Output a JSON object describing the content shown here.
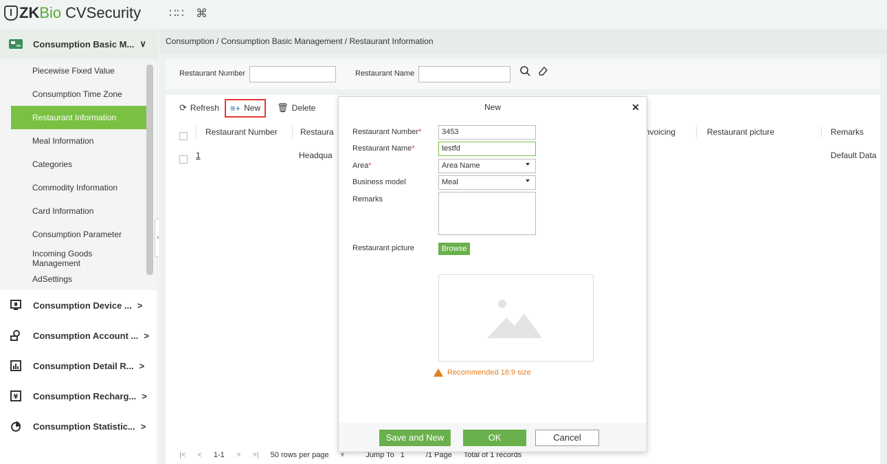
{
  "app": {
    "brand_zk": "ZK",
    "brand_bio": "Bio",
    "brand_rest": "CVSecurity"
  },
  "sidebar": {
    "open_module": "Consumption Basic M...",
    "items": [
      "Piecewise Fixed Value",
      "Consumption Time Zone",
      "Restaurant Information",
      "Meal Information",
      "Categories",
      "Commodity Information",
      "Card Information",
      "Consumption Parameter",
      "Incoming Goods Management",
      "AdSettings"
    ],
    "active_item": "Restaurant Information",
    "modules": [
      "Consumption Device ...",
      "Consumption Account ...",
      "Consumption Detail R...",
      "Consumption Recharg...",
      "Consumption Statistic..."
    ]
  },
  "breadcrumb": "Consumption / Consumption Basic Management / Restaurant Information",
  "search": {
    "number_label": "Restaurant Number",
    "number_value": "",
    "name_label": "Restaurant Name",
    "name_value": ""
  },
  "toolbar": {
    "refresh": "Refresh",
    "new": "New",
    "delete": "Delete"
  },
  "table": {
    "headers": [
      "Restaurant Number",
      "Restaura",
      "nvoicing",
      "Restaurant picture",
      "Remarks"
    ],
    "rows": [
      {
        "number": "1",
        "name": "Headqua",
        "remarks": "Default Data"
      }
    ]
  },
  "pager": {
    "range": "1-1",
    "rows_per_page": "50 rows per page",
    "jump_label": "Jump To",
    "jump_value": "1",
    "pages": "/1 Page",
    "total": "Total of 1 records"
  },
  "dialog": {
    "title": "New",
    "fields": {
      "number_label": "Restaurant Number",
      "number_value": "3453",
      "name_label": "Restaurant Name",
      "name_value": "testfd",
      "area_label": "Area",
      "area_value": "Area Name",
      "model_label": "Business model",
      "model_value": "Meal",
      "remarks_label": "Remarks",
      "picture_label": "Restaurant picture"
    },
    "browse": "Browse",
    "hint": "Recommended 16:9 size",
    "buttons": {
      "save_new": "Save and New",
      "ok": "OK",
      "cancel": "Cancel"
    }
  },
  "colors": {
    "accent": "#7ac143",
    "button_green": "#6ab04c",
    "highlight_red": "#e53935",
    "warning": "#e67e22"
  }
}
